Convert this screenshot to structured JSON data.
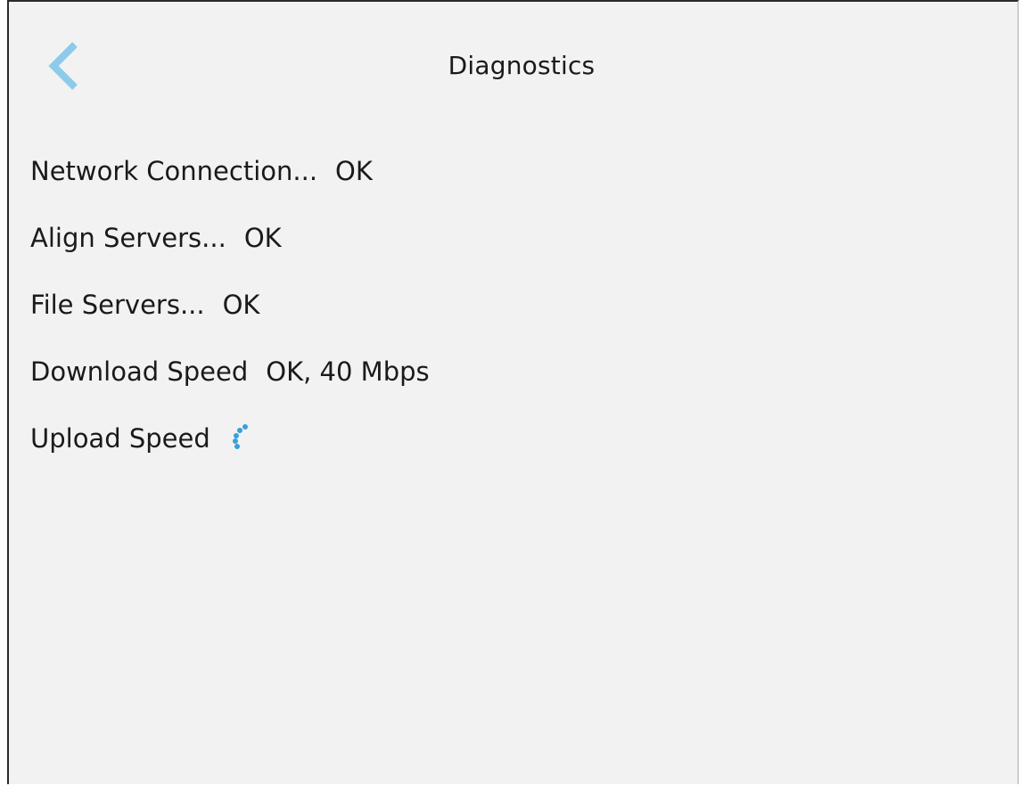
{
  "header": {
    "title": "Diagnostics",
    "back_icon": "chevron-left-icon",
    "back_icon_color": "#8ccbea"
  },
  "diagnostics": [
    {
      "label": "Network Connection...",
      "status": "OK"
    },
    {
      "label": "Align Servers...",
      "status": "OK"
    },
    {
      "label": "File Servers...",
      "status": "OK"
    },
    {
      "label": "Download Speed",
      "status": "OK, 40  Mbps"
    },
    {
      "label": "Upload Speed",
      "status": ""
    }
  ],
  "loading_indicator": {
    "icon": "loading-spinner-icon",
    "color": "#3a9fd6"
  }
}
